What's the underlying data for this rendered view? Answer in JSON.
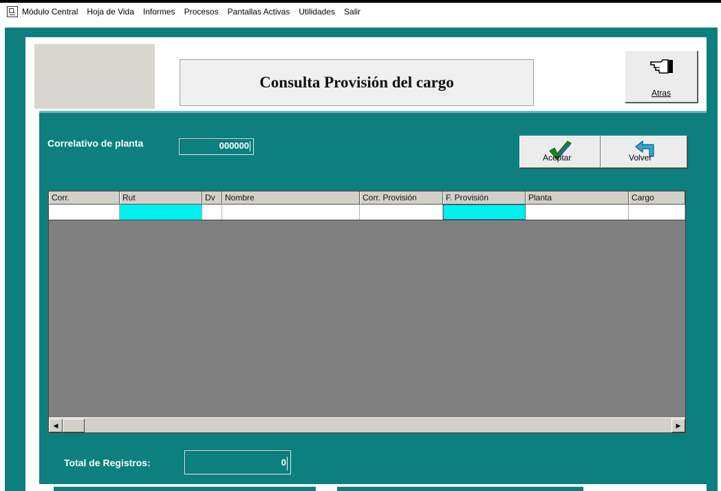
{
  "menu": {
    "items": [
      "Módulo Central",
      "Hoja de Vida",
      "Informes",
      "Procesos",
      "Pantallas Activas",
      "Utilidades",
      "Salir"
    ]
  },
  "header": {
    "title": "Consulta Provisión del cargo",
    "back_button_label": "Atras"
  },
  "form": {
    "correlativo_label": "Correlativo de planta",
    "correlativo_value": "000000",
    "aceptar_label": "Aceptar",
    "volver_label": "Volver",
    "total_label": "Total de Registros:",
    "total_value": "0"
  },
  "grid": {
    "columns": [
      "Corr.",
      "Rut",
      "Dv",
      "Nombre",
      "Corr. Provisión",
      "F. Provisión",
      "Planta",
      "Cargo"
    ],
    "rows": [
      [
        "",
        "",
        "",
        "",
        "",
        "",
        "",
        ""
      ]
    ]
  },
  "colors": {
    "teal": "#0d7f7f",
    "selected_cell": "#00f0f0",
    "grid_empty": "#808080"
  }
}
